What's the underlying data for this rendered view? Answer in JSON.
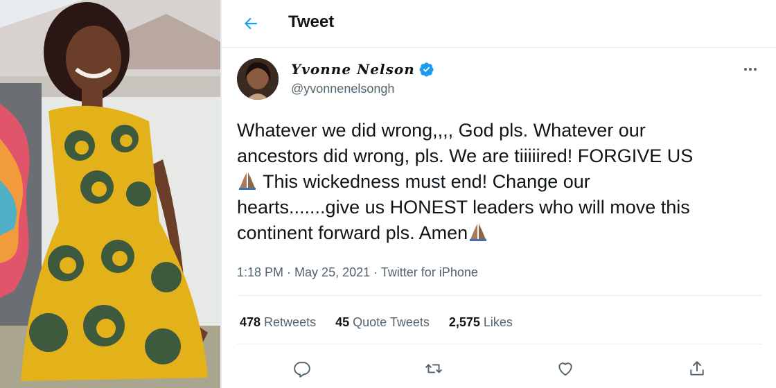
{
  "header": {
    "title": "Tweet",
    "back_icon": "arrow-left-icon"
  },
  "author": {
    "display_name": "Yvonne Nelson",
    "handle": "@yvonnenelsongh",
    "verified_icon": "verified-badge-icon"
  },
  "tweet": {
    "text_lines": [
      "Whatever we did wrong,,,, God pls. Whatever our",
      "ancestors did wrong, pls. We are tiiiiired! FORGIVE US",
      " This wickedness must end! Change our",
      "hearts.......give us HONEST leaders who will move this",
      "continent forward pls. Amen"
    ],
    "time": "1:18 PM",
    "date": "May 25, 2021",
    "source": "Twitter for iPhone",
    "separator": " · "
  },
  "stats": {
    "retweets": {
      "count": "478",
      "label": "Retweets"
    },
    "quote_tweets": {
      "count": "45",
      "label": "Quote Tweets"
    },
    "likes": {
      "count": "2,575",
      "label": "Likes"
    }
  },
  "actions": [
    "reply-icon",
    "retweet-icon",
    "like-icon",
    "share-icon"
  ],
  "colors": {
    "accent": "#1d9bf0",
    "text": "#0f1419",
    "muted": "#536471",
    "border": "#e6ecf0"
  }
}
